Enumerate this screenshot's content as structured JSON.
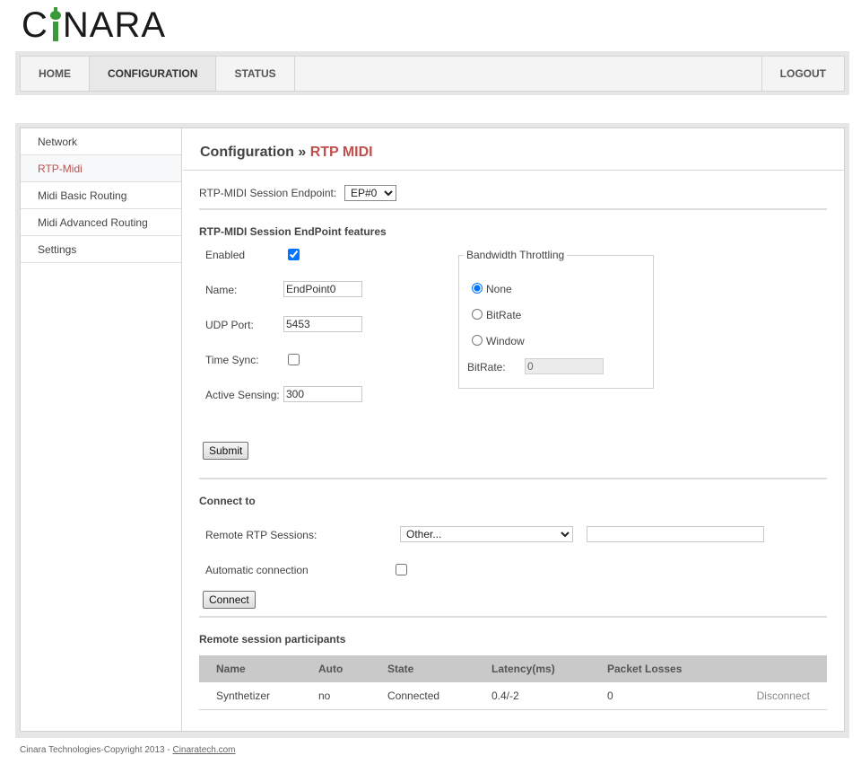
{
  "brand": {
    "logo_prefix": "C",
    "logo_suffix": "NARA"
  },
  "topnav": {
    "items": [
      {
        "label": "HOME"
      },
      {
        "label": "CONFIGURATION",
        "active": true
      },
      {
        "label": "STATUS"
      }
    ],
    "logout": "LOGOUT"
  },
  "sidebar": {
    "items": [
      {
        "label": "Network"
      },
      {
        "label": "RTP-Midi",
        "active": true
      },
      {
        "label": "Midi Basic Routing"
      },
      {
        "label": "Midi Advanced Routing"
      },
      {
        "label": "Settings"
      }
    ]
  },
  "page": {
    "title_main": "Configuration",
    "title_sep": "»",
    "title_crumb": "RTP MIDI"
  },
  "endpoint": {
    "label": "RTP-MIDI Session Endpoint:",
    "selected": "EP#0"
  },
  "features": {
    "heading": "RTP-MIDI Session EndPoint features",
    "enabled_label": "Enabled",
    "enabled_checked": true,
    "name_label": "Name:",
    "name_value": "EndPoint0",
    "udp_label": "UDP Port:",
    "udp_value": "5453",
    "timesync_label": "Time Sync:",
    "timesync_checked": false,
    "active_sensing_label": "Active Sensing:",
    "active_sensing_value": "300",
    "submit_label": "Submit"
  },
  "bandwidth": {
    "legend": "Bandwidth Throttling",
    "options": [
      {
        "label": "None",
        "checked": true
      },
      {
        "label": "BitRate",
        "checked": false
      },
      {
        "label": "Window",
        "checked": false
      }
    ],
    "bitrate_label": "BitRate:",
    "bitrate_value": "0"
  },
  "connect": {
    "heading": "Connect to",
    "remote_label": "Remote RTP Sessions:",
    "remote_selected": "Other...",
    "remote_input_value": "",
    "auto_label": "Automatic connection",
    "auto_checked": false,
    "connect_label": "Connect"
  },
  "participants": {
    "heading": "Remote session participants",
    "columns": [
      "Name",
      "Auto",
      "State",
      "Latency(ms)",
      "Packet Losses",
      ""
    ],
    "rows": [
      {
        "name": "Synthetizer",
        "auto": "no",
        "state": "Connected",
        "latency": "0.4/-2",
        "losses": "0",
        "action": "Disconnect"
      }
    ]
  },
  "footer": {
    "text": "Cinara Technologies-Copyright 2013 - ",
    "link": "Cinaratech.com"
  },
  "colors": {
    "accent": "#c0504d",
    "logo_green": "#3a9a3a"
  }
}
